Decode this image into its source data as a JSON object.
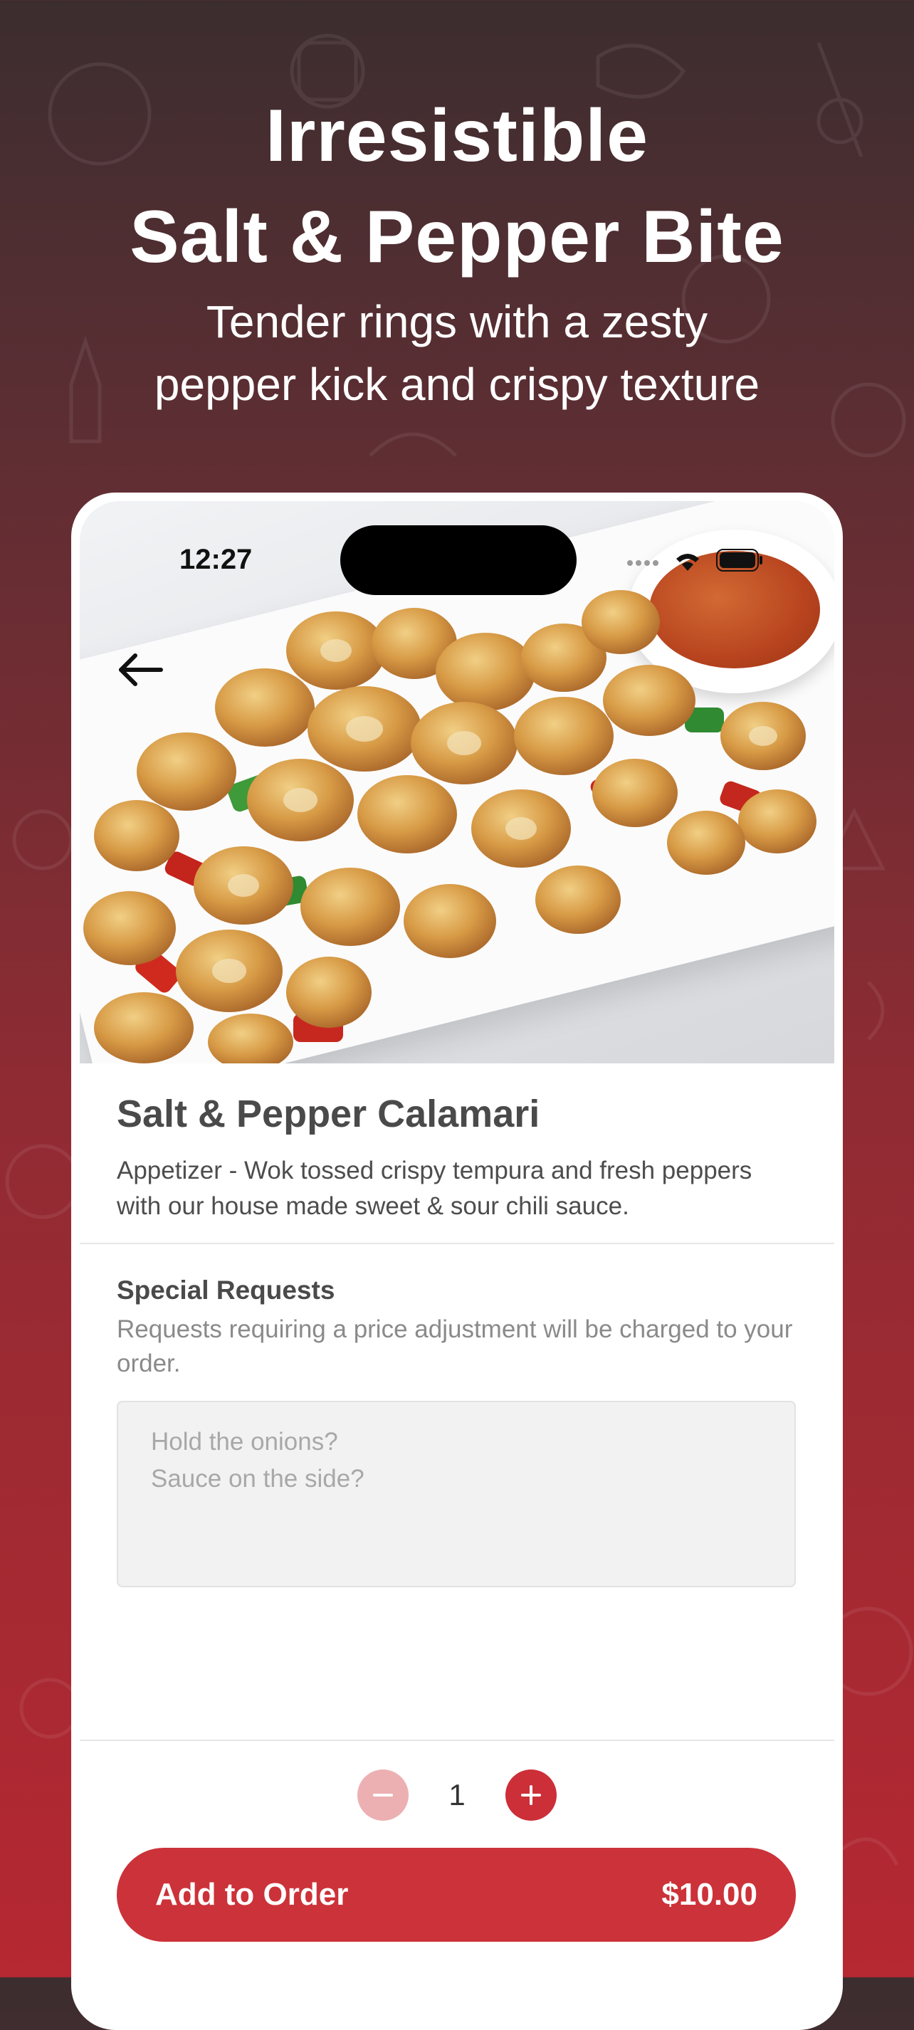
{
  "hero": {
    "title_line1": "Irresistible",
    "title_line2": "Salt & Pepper Bite",
    "subtitle_line1": "Tender rings with a zesty",
    "subtitle_line2": "pepper kick and crispy texture"
  },
  "status_bar": {
    "time": "12:27",
    "icons": [
      "signal-icon",
      "wifi-icon",
      "battery-icon"
    ]
  },
  "item": {
    "name": "Salt & Pepper Calamari",
    "description": "Appetizer - Wok tossed crispy tempura and fresh peppers with our house made sweet & sour chili sauce."
  },
  "requests": {
    "title": "Special Requests",
    "note": "Requests requiring a price adjustment will be charged to your order.",
    "placeholder": "Hold the onions?\nSauce on the side?",
    "value": ""
  },
  "order": {
    "quantity": "1",
    "add_label": "Add to Order",
    "price": "$10.00"
  },
  "colors": {
    "accent": "#cc3239",
    "minus_disabled": "#ecb0b3",
    "bg_top": "#3c2d2f",
    "bg_bottom": "#b62832"
  }
}
